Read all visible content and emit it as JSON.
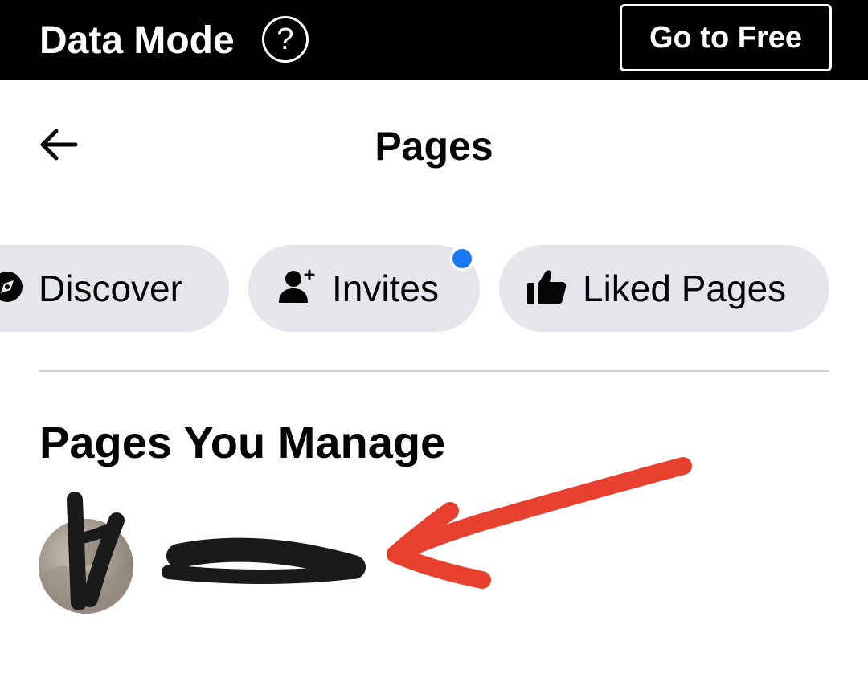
{
  "data_banner": {
    "title": "Data Mode",
    "help_icon": "question-circle-icon",
    "go_free_label": "Go to Free"
  },
  "header": {
    "back_icon": "arrow-left-icon",
    "title": "Pages"
  },
  "chips": [
    {
      "label": "Discover",
      "icon": "compass-icon"
    },
    {
      "label": "Invites",
      "icon": "person-add-icon",
      "has_notification": true
    },
    {
      "label": "Liked Pages",
      "icon": "thumbs-up-icon"
    }
  ],
  "section": {
    "title": "Pages You Manage"
  },
  "managed_pages": [
    {
      "name": "Page name (redacted)",
      "avatar": "page-avatar",
      "redacted": true
    }
  ],
  "annotation": {
    "arrow_color": "#e8402f",
    "redaction_color": "#1a1a1a"
  },
  "colors": {
    "banner_bg": "#000000",
    "chip_bg": "#e4e6eb",
    "notification_dot": "#1877f2",
    "divider": "#cfd2d6"
  }
}
